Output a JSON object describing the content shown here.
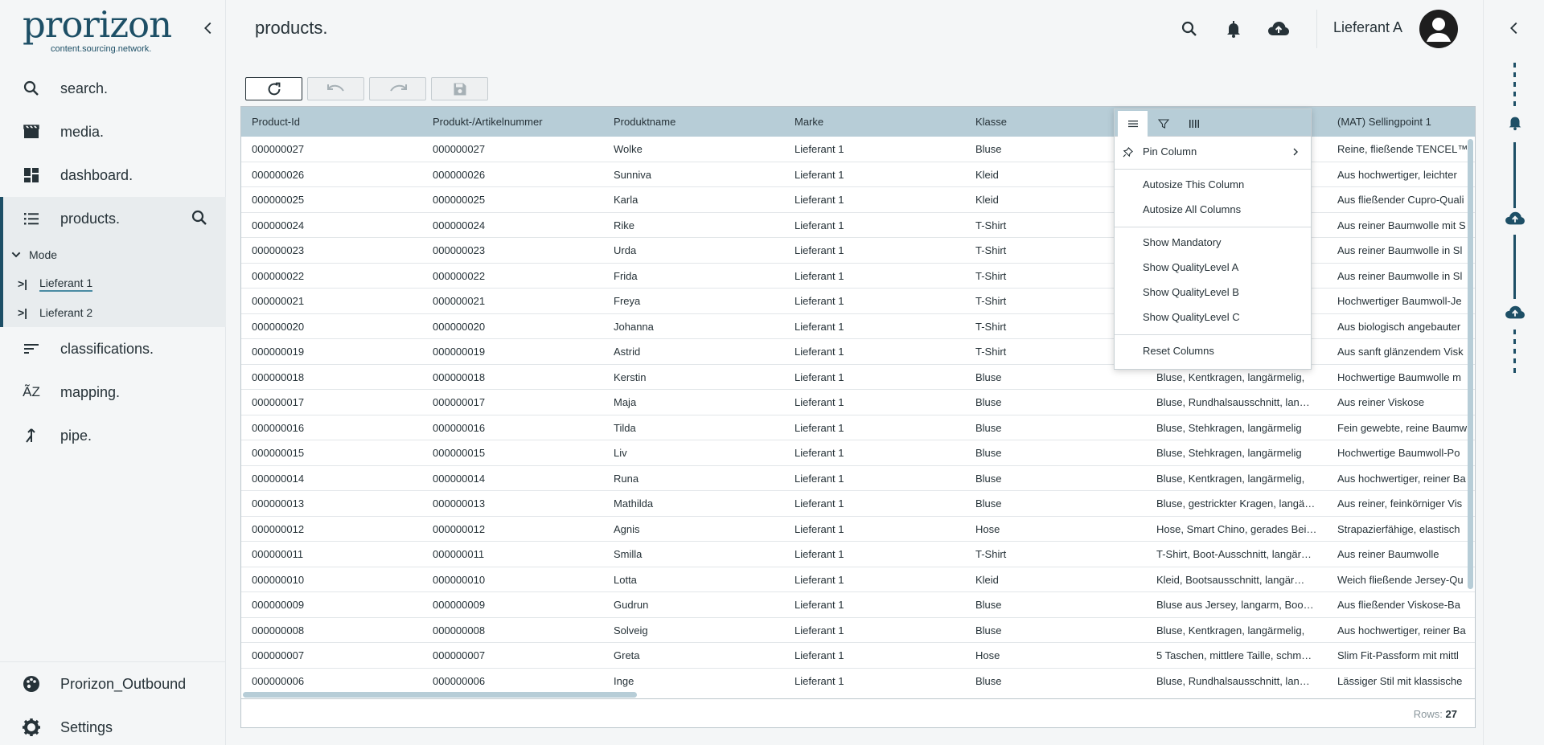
{
  "app": {
    "logo_main": "prorizon",
    "logo_sub": "content.sourcing.network."
  },
  "sidebar": {
    "items": [
      {
        "label": "search.",
        "icon": "search-icon"
      },
      {
        "label": "media.",
        "icon": "clapperboard-icon"
      },
      {
        "label": "dashboard.",
        "icon": "dashboard-icon"
      },
      {
        "label": "products.",
        "icon": "list-icon"
      },
      {
        "label": "classifications.",
        "icon": "sort-lines-icon"
      },
      {
        "label": "mapping.",
        "icon": "az-icon"
      },
      {
        "label": "pipe.",
        "icon": "merge-icon"
      }
    ],
    "mode_label": "Mode",
    "sub_items": [
      "Lieferant 1",
      "Lieferant 2"
    ],
    "bottom": [
      {
        "label": "Prorizon_Outbound",
        "icon": "palette-icon"
      },
      {
        "label": "Settings",
        "icon": "gear-icon"
      }
    ]
  },
  "header": {
    "title": "products.",
    "user": "Lieferant A"
  },
  "grid": {
    "columns": [
      "Product-Id",
      "Produkt-/Artikelnummer",
      "Produktname",
      "Marke",
      "Klasse",
      "",
      "(MAT) Sellingpoint 1"
    ],
    "rows": [
      [
        "000000027",
        "000000027",
        "Wolke",
        "Lieferant 1",
        "Bluse",
        "",
        "Reine, fließende TENCEL™"
      ],
      [
        "000000026",
        "000000026",
        "Sunniva",
        "Lieferant 1",
        "Kleid",
        "",
        "Aus hochwertiger, leichter"
      ],
      [
        "000000025",
        "000000025",
        "Karla",
        "Lieferant 1",
        "Kleid",
        "",
        "Aus fließender Cupro-Quali"
      ],
      [
        "000000024",
        "000000024",
        "Rike",
        "Lieferant 1",
        "T-Shirt",
        "",
        "Aus reiner Baumwolle mit S"
      ],
      [
        "000000023",
        "000000023",
        "Urda",
        "Lieferant 1",
        "T-Shirt",
        "",
        "Aus reiner Baumwolle in Sl"
      ],
      [
        "000000022",
        "000000022",
        "Frida",
        "Lieferant 1",
        "T-Shirt",
        "",
        "Aus reiner Baumwolle in Sl"
      ],
      [
        "000000021",
        "000000021",
        "Freya",
        "Lieferant 1",
        "T-Shirt",
        "",
        "Hochwertiger Baumwoll-Je"
      ],
      [
        "000000020",
        "000000020",
        "Johanna",
        "Lieferant 1",
        "T-Shirt",
        "",
        "Aus biologisch angebauter"
      ],
      [
        "000000019",
        "000000019",
        "Astrid",
        "Lieferant 1",
        "T-Shirt",
        "",
        "Aus sanft glänzendem Visk"
      ],
      [
        "000000018",
        "000000018",
        "Kerstin",
        "Lieferant 1",
        "Bluse",
        "Bluse, Kentkragen, langärmelig,",
        "Hochwertige Baumwolle m"
      ],
      [
        "000000017",
        "000000017",
        "Maja",
        "Lieferant 1",
        "Bluse",
        "Bluse, Rundhalsausschnitt, lan…",
        "Aus reiner Viskose"
      ],
      [
        "000000016",
        "000000016",
        "Tilda",
        "Lieferant 1",
        "Bluse",
        "Bluse, Stehkragen, langärmelig",
        "Fein gewebte, reine Baumw"
      ],
      [
        "000000015",
        "000000015",
        "Liv",
        "Lieferant 1",
        "Bluse",
        "Bluse, Stehkragen, langärmelig",
        "Hochwertige Baumwoll-Po"
      ],
      [
        "000000014",
        "000000014",
        "Runa",
        "Lieferant 1",
        "Bluse",
        "Bluse, Kentkragen, langärmelig,",
        "Aus hochwertiger, reiner Ba"
      ],
      [
        "000000013",
        "000000013",
        "Mathilda",
        "Lieferant 1",
        "Bluse",
        "Bluse, gestrickter Kragen, langä…",
        "Aus reiner, feinkörniger Vis"
      ],
      [
        "000000012",
        "000000012",
        "Agnis",
        "Lieferant 1",
        "Hose",
        "Hose, Smart Chino, gerades Bei…",
        "Strapazierfähige, elastisch"
      ],
      [
        "000000011",
        "000000011",
        "Smilla",
        "Lieferant 1",
        "T-Shirt",
        "T-Shirt, Boot-Ausschnitt, langär…",
        "Aus reiner Baumwolle"
      ],
      [
        "000000010",
        "000000010",
        "Lotta",
        "Lieferant 1",
        "Kleid",
        "Kleid, Bootsausschnitt, langär…",
        "Weich fließende Jersey-Qu"
      ],
      [
        "000000009",
        "000000009",
        "Gudrun",
        "Lieferant 1",
        "Bluse",
        "Bluse aus Jersey, langarm, Boo…",
        "Aus fließender Viskose-Ba"
      ],
      [
        "000000008",
        "000000008",
        "Solveig",
        "Lieferant 1",
        "Bluse",
        "Bluse, Kentkragen, langärmelig,",
        "Aus hochwertiger, reiner Ba"
      ],
      [
        "000000007",
        "000000007",
        "Greta",
        "Lieferant 1",
        "Hose",
        "5 Taschen, mittlere Taille, schm…",
        "Slim Fit-Passform mit mittl"
      ],
      [
        "000000006",
        "000000006",
        "Inge",
        "Lieferant 1",
        "Bluse",
        "Bluse, Rundhalsausschnitt, lan…",
        "Lässiger Stil mit klassische"
      ]
    ],
    "rows_label": "Rows:",
    "rows_count": "27"
  },
  "column_menu": {
    "tabs": [
      "menu-icon",
      "filter-icon",
      "columns-icon"
    ],
    "pin_column": "Pin Column",
    "autosize_this": "Autosize This Column",
    "autosize_all": "Autosize All Columns",
    "show_mandatory": "Show Mandatory",
    "show_ql_a": "Show QualityLevel A",
    "show_ql_b": "Show QualityLevel B",
    "show_ql_c": "Show QualityLevel C",
    "reset_columns": "Reset Columns"
  },
  "colors": {
    "brand": "#1d4f66",
    "grid_header": "#b7cdd7",
    "text": "#263238"
  }
}
